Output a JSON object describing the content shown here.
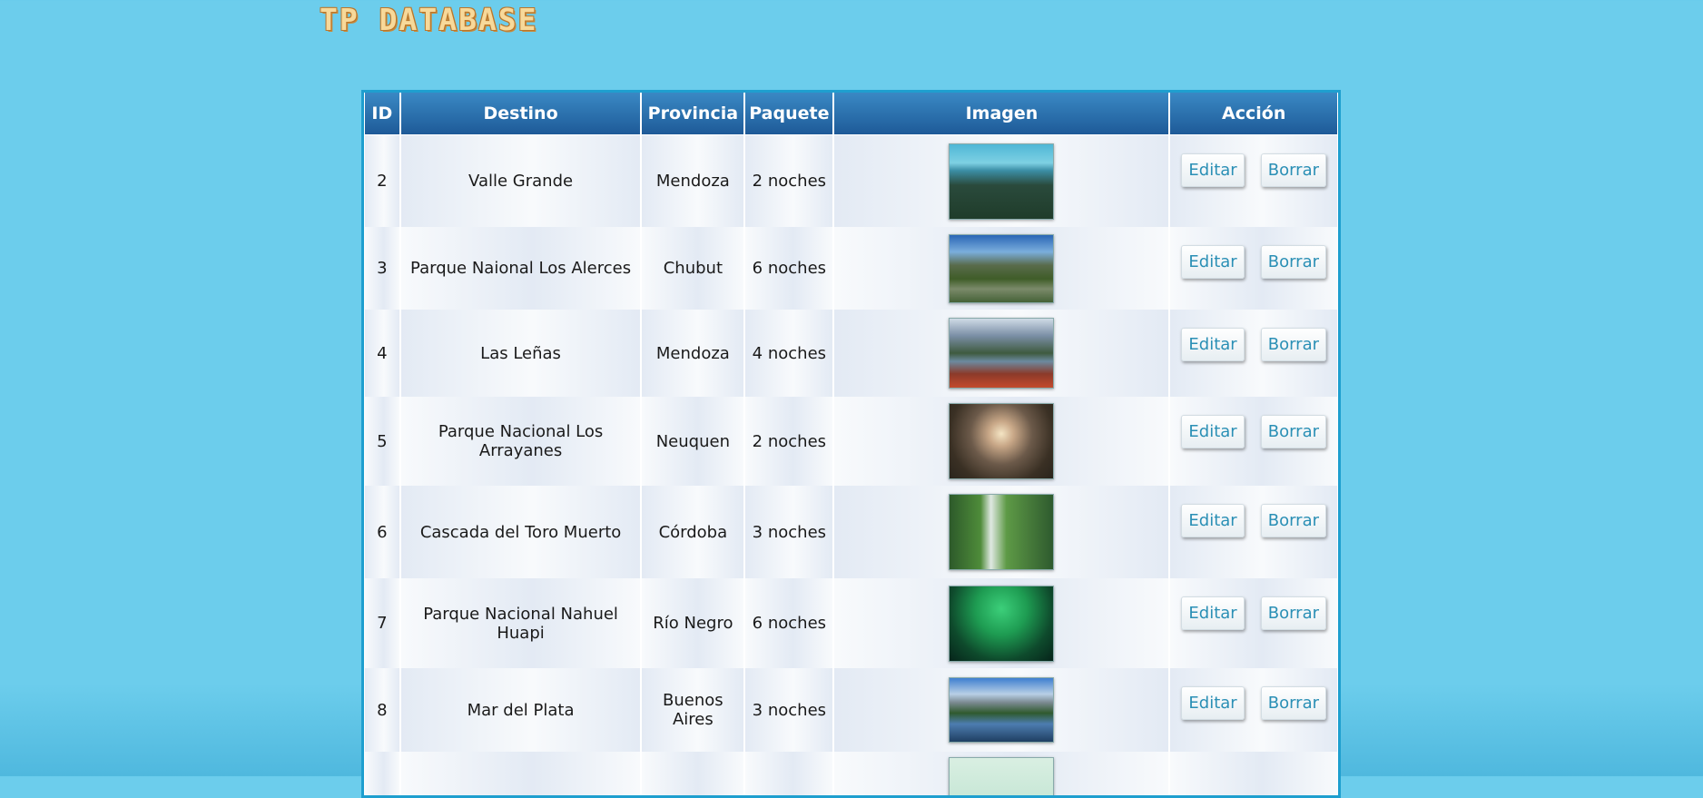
{
  "header": {
    "logo_text": "TP DATABASE"
  },
  "table": {
    "columns": [
      "ID",
      "Destino",
      "Provincia",
      "Paquete",
      "Imagen",
      "Acción"
    ],
    "rows": [
      {
        "id": "2",
        "destino": "Valle Grande",
        "provincia": "Mendoza",
        "paquete": "2 noches",
        "image_icon": "lake-forest-image",
        "edit_label": "Editar",
        "delete_label": "Borrar"
      },
      {
        "id": "3",
        "destino": "Parque Naional Los Alerces",
        "provincia": "Chubut",
        "paquete": "6 noches",
        "image_icon": "mountain-river-image",
        "edit_label": "Editar",
        "delete_label": "Borrar"
      },
      {
        "id": "4",
        "destino": "Las Leñas",
        "provincia": "Mendoza",
        "paquete": "4 noches",
        "image_icon": "autumn-mountain-lake-image",
        "edit_label": "Editar",
        "delete_label": "Borrar"
      },
      {
        "id": "5",
        "destino": "Parque Nacional Los Arrayanes",
        "provincia": "Neuquen",
        "paquete": "2 noches",
        "image_icon": "sunset-forest-image",
        "edit_label": "Editar",
        "delete_label": "Borrar"
      },
      {
        "id": "6",
        "destino": "Cascada del Toro Muerto",
        "provincia": "Córdoba",
        "paquete": "3 noches",
        "image_icon": "waterfall-image",
        "edit_label": "Editar",
        "delete_label": "Borrar"
      },
      {
        "id": "7",
        "destino": "Parque Nacional Nahuel Huapi",
        "provincia": "Río Negro",
        "paquete": "6 noches",
        "image_icon": "aurora-image",
        "edit_label": "Editar",
        "delete_label": "Borrar"
      },
      {
        "id": "8",
        "destino": "Mar del Plata",
        "provincia": "Buenos Aires",
        "paquete": "3 noches",
        "image_icon": "mountain-lake-image",
        "edit_label": "Editar",
        "delete_label": "Borrar"
      },
      {
        "id": "",
        "destino": "",
        "provincia": "",
        "paquete": "",
        "image_icon": "partial-image",
        "edit_label": "",
        "delete_label": ""
      }
    ]
  },
  "colors": {
    "page_background": "#6ccdec",
    "header_gradient_top": "#3a89c4",
    "header_gradient_bottom": "#1e5a98",
    "table_border": "#1e9fcf",
    "button_text": "#2a8fb5",
    "logo_fill": "#f7d99a"
  }
}
